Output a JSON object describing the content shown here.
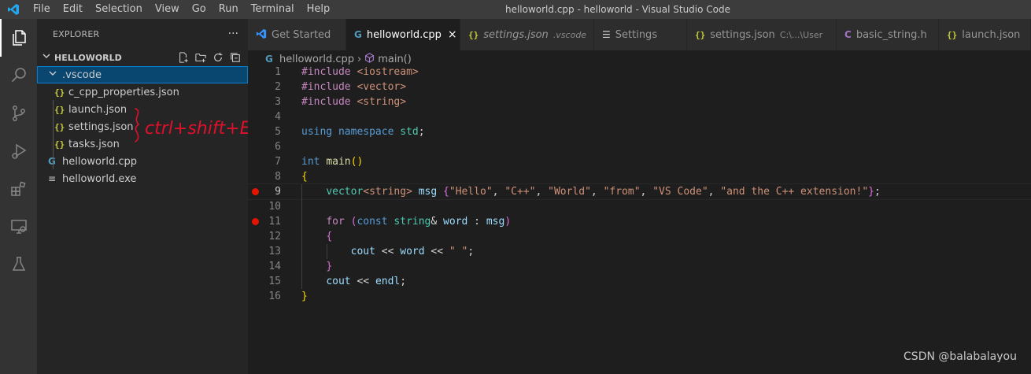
{
  "window": {
    "title": "helloworld.cpp - helloworld - Visual Studio Code"
  },
  "menu": [
    "File",
    "Edit",
    "Selection",
    "View",
    "Go",
    "Run",
    "Terminal",
    "Help"
  ],
  "activity_bar": [
    "explorer-icon",
    "search-icon",
    "source-control-icon",
    "run-debug-icon",
    "extensions-icon",
    "remote-explorer-icon",
    "testing-icon"
  ],
  "sidebar": {
    "title": "EXPLORER",
    "more": "···",
    "folder": "HELLOWORLD",
    "tree": [
      {
        "label": ".vscode",
        "type": "folder",
        "expanded": true,
        "selected": true
      },
      {
        "label": "c_cpp_properties.json",
        "type": "json"
      },
      {
        "label": "launch.json",
        "type": "json"
      },
      {
        "label": "settings.json",
        "type": "json"
      },
      {
        "label": "tasks.json",
        "type": "json"
      },
      {
        "label": "helloworld.cpp",
        "type": "cpp"
      },
      {
        "label": "helloworld.exe",
        "type": "exe"
      }
    ]
  },
  "tabs": [
    {
      "label": "Get Started",
      "icon": "vscode-icon"
    },
    {
      "label": "helloworld.cpp",
      "icon": "cpp-icon",
      "active": true,
      "close": "×"
    },
    {
      "label": "settings.json",
      "icon": "json-icon",
      "desc": ".vscode",
      "italic": true
    },
    {
      "label": "Settings",
      "icon": "settings-lines-icon"
    },
    {
      "label": "settings.json",
      "icon": "json-icon",
      "desc": "C:\\...\\User"
    },
    {
      "label": "basic_string.h",
      "icon": "c-icon"
    },
    {
      "label": "launch.json",
      "icon": "json-icon"
    }
  ],
  "breadcrumb": {
    "file": "helloworld.cpp",
    "symbol": "main()"
  },
  "editor": {
    "current_line": 9,
    "breakpoints": [
      9,
      11
    ],
    "lines": [
      "#include <iostream>",
      "#include <vector>",
      "#include <string>",
      "",
      "using namespace std;",
      "",
      "int main()",
      "{",
      "    vector<string> msg {\"Hello\", \"C++\", \"World\", \"from\", \"VS Code\", \"and the C++ extension!\"};",
      "",
      "    for (const string& word : msg)",
      "    {",
      "        cout << word << \" \";",
      "    }",
      "    cout << endl;",
      "}"
    ]
  },
  "annotation": {
    "text": "ctrl+shift+E",
    "color": "#e0102b"
  },
  "watermark": "CSDN @balabalayou"
}
